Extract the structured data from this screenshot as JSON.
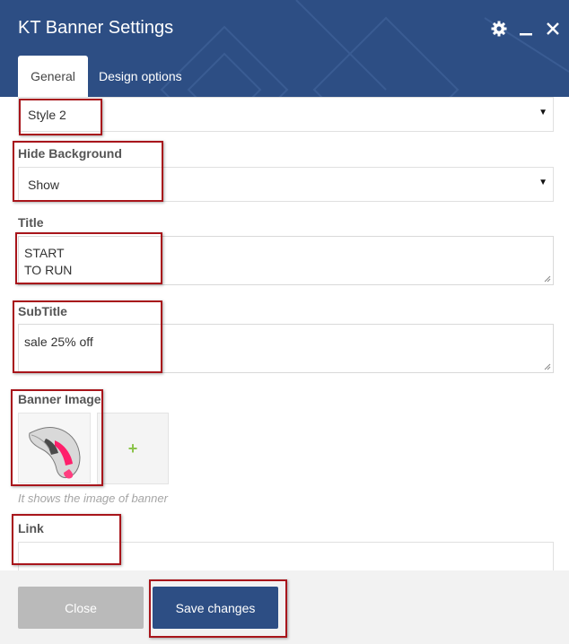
{
  "dialog": {
    "title": "KT Banner Settings",
    "icons": [
      "gear-icon",
      "minimize-icon",
      "close-icon"
    ],
    "colors": {
      "header": "#2d4e84",
      "annotation": "#a8151b",
      "add": "#8bc34a"
    }
  },
  "tabs": [
    {
      "label": "General",
      "active": true
    },
    {
      "label": "Design options",
      "active": false
    }
  ],
  "form": {
    "style": {
      "value": "Style 2"
    },
    "hide_background": {
      "label": "Hide Background",
      "value": "Show"
    },
    "title": {
      "label": "Title",
      "value": "START\nTO RUN"
    },
    "subtitle": {
      "label": "SubTitle",
      "value": "sale 25% off"
    },
    "banner_image": {
      "label": "Banner Image",
      "add_symbol": "+",
      "hint": "It shows the image of banner"
    },
    "link": {
      "label": "Link",
      "value": ""
    }
  },
  "footer": {
    "close_label": "Close",
    "save_label": "Save changes"
  }
}
